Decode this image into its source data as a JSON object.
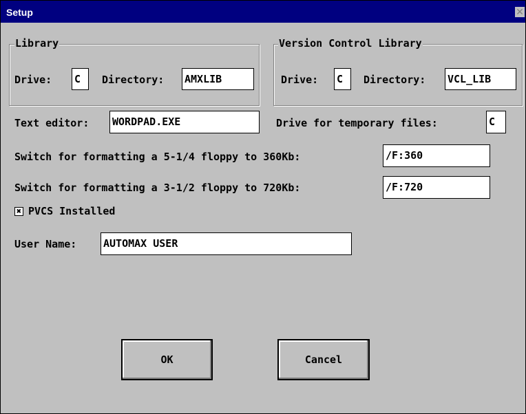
{
  "window": {
    "title": "Setup",
    "close_glyph": "✕"
  },
  "library": {
    "legend": "Library",
    "drive_label": "Drive:",
    "drive_value": "C",
    "directory_label": "Directory:",
    "directory_value": "AMXLIB"
  },
  "vcl": {
    "legend": "Version Control Library",
    "drive_label": "Drive:",
    "drive_value": "C",
    "directory_label": "Directory:",
    "directory_value": "VCL_LIB"
  },
  "editor": {
    "label": "Text editor:",
    "value": "WORDPAD.EXE"
  },
  "temp": {
    "label": "Drive for temporary files:",
    "value": "C"
  },
  "floppy525": {
    "label": "Switch for formatting a 5-1/4 floppy to 360Kb:",
    "value": "/F:360"
  },
  "floppy35": {
    "label": "Switch for formatting a 3-1/2 floppy to 720Kb:",
    "value": "/F:720"
  },
  "pvcs": {
    "label": "PVCS Installed",
    "checked": true,
    "mark": "✖"
  },
  "user": {
    "label": "User Name:",
    "value": "AUTOMAX USER"
  },
  "buttons": {
    "ok": "OK",
    "cancel": "Cancel"
  }
}
